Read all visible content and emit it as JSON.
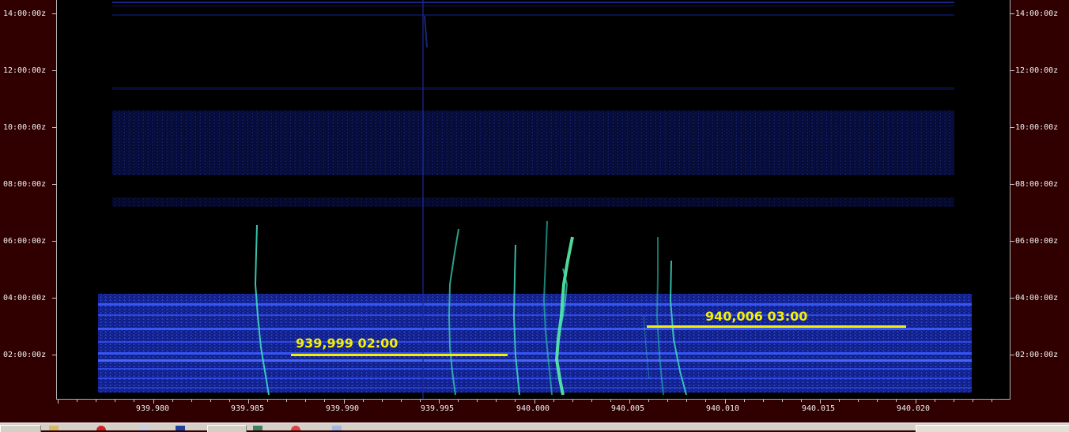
{
  "waterfall": {
    "time_labels": [
      "14:00:00z",
      "12:00:00z",
      "10:00:00z",
      "08:00:00z",
      "06:00:00z",
      "04:00:00z",
      "02:00:00z"
    ],
    "freq_labels": [
      "939.980",
      "939.985",
      "939.990",
      "939.995",
      "940.000",
      "940.005",
      "940.010",
      "940.015",
      "940.020"
    ],
    "annotations": [
      {
        "text": "939,999 02:00"
      },
      {
        "text": "940,006 03:00"
      }
    ]
  },
  "taskbar": {
    "icons": [
      "window-icon",
      "folder-icon",
      "stop-icon",
      "network-icon",
      "user-icon",
      "window-icon",
      "chart-icon",
      "record-icon",
      "window-icon"
    ]
  },
  "colors": {
    "background": "#300000",
    "plot": "#000000",
    "noise_blue": "#1a2aa8",
    "trace_cyan": "#38d8b8",
    "annotation": "#f5f000"
  }
}
